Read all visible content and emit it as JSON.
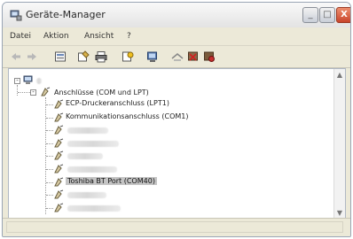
{
  "window": {
    "title": "Geräte-Manager"
  },
  "title_buttons": {
    "minimize": "_",
    "maximize": "□",
    "close": "X"
  },
  "menu": [
    "Datei",
    "Aktion",
    "Ansicht",
    "?"
  ],
  "toolbar": {
    "icons": [
      "back-arrow-icon",
      "forward-arrow-icon",
      "view-icon",
      "properties-icon",
      "print-icon",
      "help-icon",
      "scan-hardware-icon",
      "update-driver-icon",
      "uninstall-icon",
      "disable-icon"
    ]
  },
  "tree": {
    "root_expander": "-",
    "group_expander": "-",
    "group_label": "Anschlüsse (COM und LPT)",
    "children": [
      {
        "label": "ECP-Druckeranschluss (LPT1)",
        "blurred": false,
        "selected": false
      },
      {
        "label": "Kommunikationsanschluss (COM1)",
        "blurred": false,
        "selected": false
      },
      {
        "label": "",
        "blurred": true,
        "selected": false
      },
      {
        "label": "",
        "blurred": true,
        "selected": false
      },
      {
        "label": "",
        "blurred": true,
        "selected": false
      },
      {
        "label": "",
        "blurred": true,
        "selected": false
      },
      {
        "label": "Toshiba BT Port (COM40)",
        "blurred": false,
        "selected": true
      },
      {
        "label": "",
        "blurred": true,
        "selected": false
      },
      {
        "label": "",
        "blurred": true,
        "selected": false
      }
    ]
  },
  "scrollbar": {
    "up": "▲",
    "down": "▼"
  }
}
